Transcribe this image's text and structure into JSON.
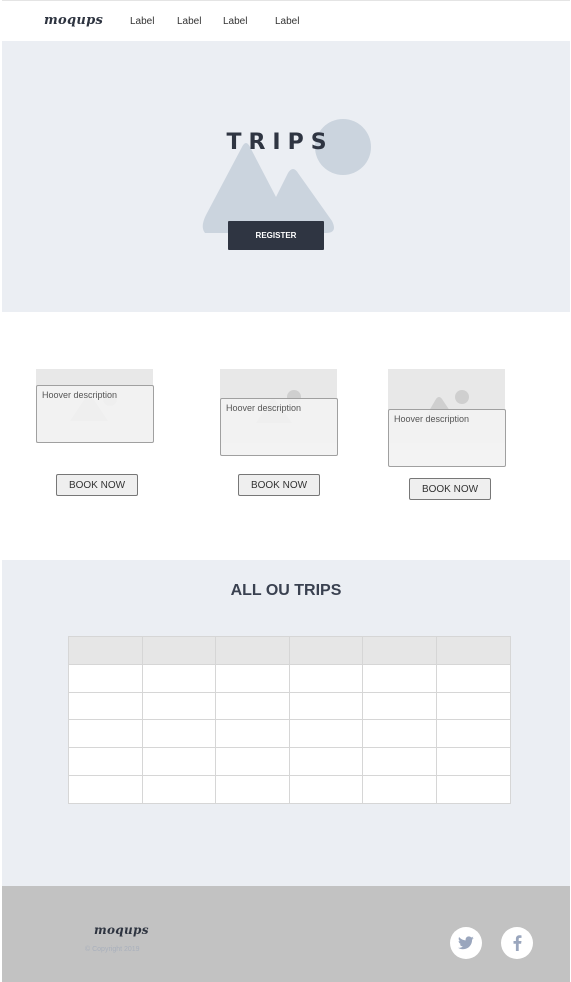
{
  "nav": {
    "logo": "moqups",
    "links": [
      "Label",
      "Label",
      "Label",
      "Label"
    ]
  },
  "hero": {
    "title": "TRIPS",
    "register_label": "REGISTER"
  },
  "cards": [
    {
      "tooltip": "Hoover description",
      "button": "BOOK NOW"
    },
    {
      "tooltip": "Hoover description",
      "button": "BOOK NOW"
    },
    {
      "tooltip": "Hoover description",
      "button": "BOOK NOW"
    }
  ],
  "trips_section": {
    "title": "ALL OU TRIPS"
  },
  "footer": {
    "logo": "moqups",
    "copyright": "© Copyright 2019",
    "social_icons": [
      "twitter-icon",
      "facebook-icon"
    ]
  },
  "colors": {
    "dark": "#2f3542",
    "section_bg": "#ebeef3",
    "footer_bg": "#c2c2c2",
    "social_icon": "#9aa6bd"
  }
}
